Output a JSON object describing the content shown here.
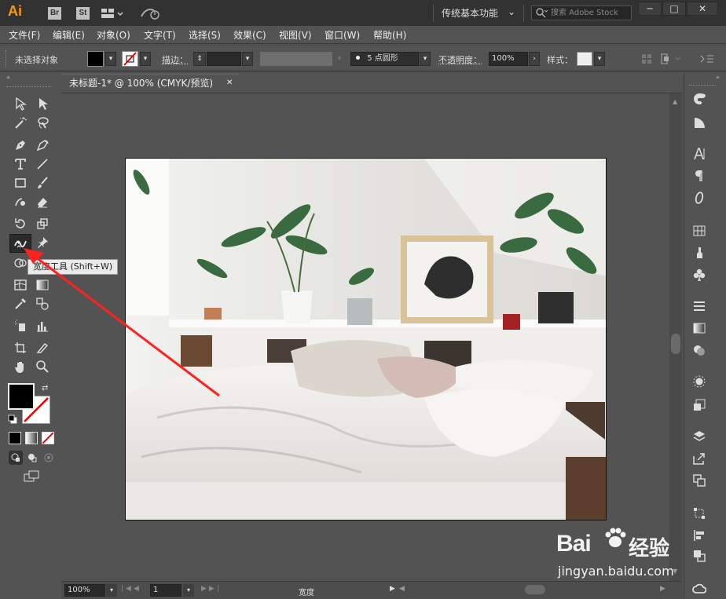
{
  "app": {
    "logo": "Ai",
    "bridge": "Br",
    "stock": "St"
  },
  "workspace": {
    "label": "传统基本功能",
    "search_placeholder": "搜索 Adobe Stock"
  },
  "menu": [
    "文件(F)",
    "编辑(E)",
    "对象(O)",
    "文字(T)",
    "选择(S)",
    "效果(C)",
    "视图(V)",
    "窗口(W)",
    "帮助(H)"
  ],
  "control": {
    "selection": "未选择对象",
    "stroke_label": "描边：",
    "brush": "5 点圆形",
    "opacity_label": "不透明度：",
    "opacity_value": "100%",
    "style_label": "样式："
  },
  "document": {
    "tab_title": "未标题-1* @ 100% (CMYK/预览)"
  },
  "tooltip": {
    "text": "宽度工具 (Shift+W)"
  },
  "status": {
    "zoom": "100%",
    "page": "1",
    "tool": "宽度"
  },
  "watermark": {
    "brand": "Bai",
    "brand_suffix": "经验",
    "url": "jingyan.baidu.com"
  },
  "colors": {
    "accent": "#ff9a00",
    "annotation": "#ff2020"
  }
}
